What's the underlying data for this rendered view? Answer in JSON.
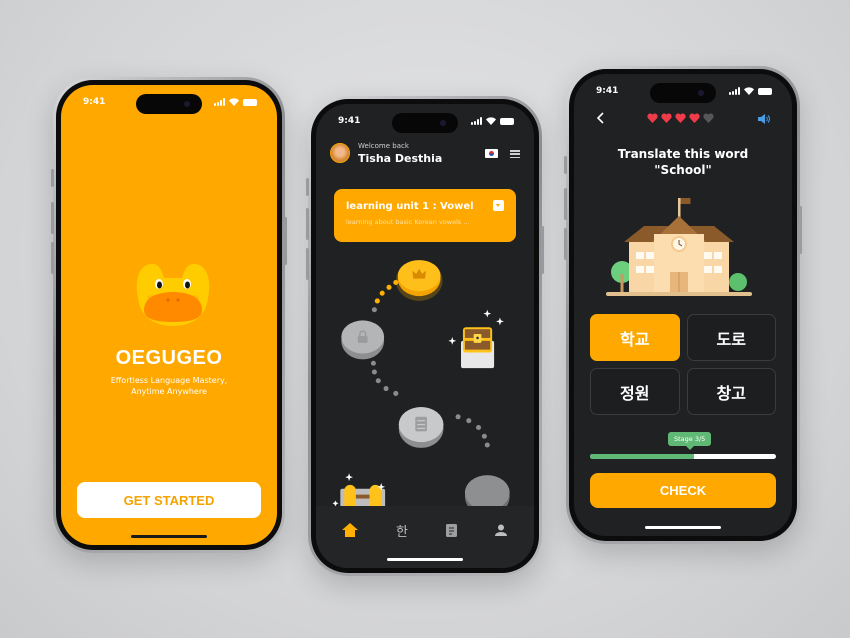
{
  "status_bar": {
    "time": "9:41"
  },
  "onboarding": {
    "brand": "OEGUGEO",
    "tagline_line1": "Effortless Language Mastery,",
    "tagline_line2": "Anytime Anywhere",
    "cta_label": "GET STARTED",
    "bg_color": "#ffa800"
  },
  "home": {
    "welcome": "Welcome back",
    "user_name": "Tisha Desthia",
    "language_flag": "south-korea-flag",
    "unit": {
      "title": "learning unit 1 : Vowel",
      "subtitle": "learning about basic Korean vowels ..."
    },
    "path_nodes": [
      {
        "type": "crown",
        "state": "completed"
      },
      {
        "type": "lock",
        "state": "locked"
      },
      {
        "type": "treasure-chest",
        "state": "reward"
      },
      {
        "type": "checklist",
        "state": "locked"
      },
      {
        "type": "dumbbell",
        "state": "reward"
      },
      {
        "type": "lock",
        "state": "locked"
      }
    ],
    "tabs": [
      {
        "name": "home",
        "icon": "home-icon",
        "glyph": "",
        "active": true
      },
      {
        "name": "hangul",
        "icon": "hangul-icon",
        "glyph": "한",
        "active": false
      },
      {
        "name": "notes",
        "icon": "notebook-icon",
        "glyph": "",
        "active": false
      },
      {
        "name": "profile",
        "icon": "profile-icon",
        "glyph": "",
        "active": false
      }
    ]
  },
  "quiz": {
    "hearts_total": 5,
    "hearts_remaining": 4,
    "prompt_line1": "Translate this word",
    "prompt_line2": "\"School\"",
    "options": [
      {
        "label": "학교",
        "selected": true
      },
      {
        "label": "도로",
        "selected": false
      },
      {
        "label": "정원",
        "selected": false
      },
      {
        "label": "창고",
        "selected": false
      }
    ],
    "stage_label": "Stage 3/5",
    "progress": 0.56,
    "check_label": "CHECK"
  },
  "colors": {
    "accent": "#ffa800",
    "dark_bg": "#1f2122",
    "success": "#5fb874",
    "heart": "#ef3b4a"
  }
}
